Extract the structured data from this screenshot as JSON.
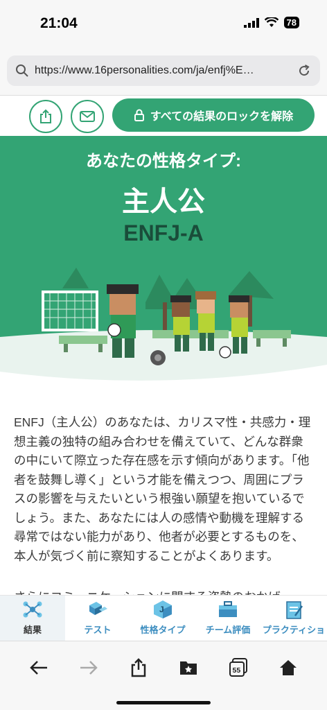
{
  "status": {
    "time": "21:04",
    "battery": "78"
  },
  "browser": {
    "url": "https://www.16personalities.com/ja/enfj%E…",
    "tab_count": "55"
  },
  "toolbar": {
    "unlock_label": "すべての結果のロックを解除"
  },
  "hero": {
    "subtitle": "あなたの性格タイプ:",
    "title": "主人公",
    "code": "ENFJ-A"
  },
  "description": "ENFJ（主人公）のあなたは、カリスマ性・共感力・理想主義の独特の組み合わせを備えていて、どんな群衆の中にいて際立った存在感を示す傾向があります。「他者を鼓舞し導く」という才能を備えつつ、周囲にプラスの影響を与えたいという根強い願望を抱いているでしょう。また、あなたには人の感情や動機を理解する尋常ではない能力があり、他者が必要とするものを、本人が気づく前に察知することがよくあります。",
  "description_more": "さらにコミュニケーションに関する姿勢のおかげ",
  "tabs": [
    {
      "label": "結果",
      "icon": "molecule-icon"
    },
    {
      "label": "テスト",
      "icon": "cubes-icon"
    },
    {
      "label": "性格タイプ",
      "icon": "letter-j-icon"
    },
    {
      "label": "チーム評価",
      "icon": "briefcase-icon"
    },
    {
      "label": "プラクティショ",
      "icon": "clipboard-icon"
    }
  ],
  "colors": {
    "accent": "#33a474",
    "dark_green": "#1a4d3a",
    "tab_blue": "#3d8ec0"
  }
}
